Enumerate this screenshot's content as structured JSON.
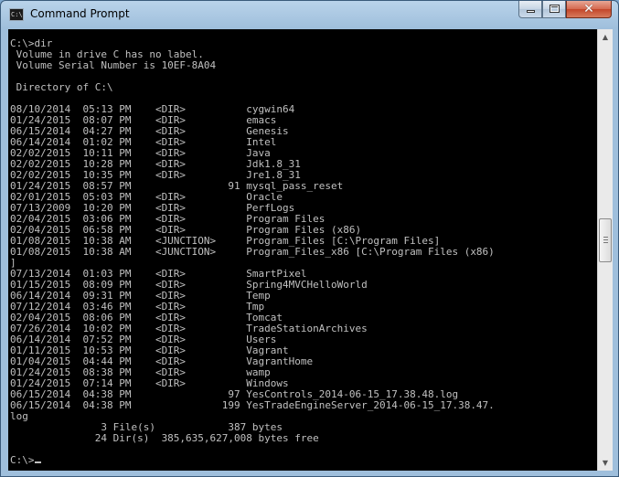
{
  "window": {
    "title": "Command Prompt",
    "icon_label": "C:\\",
    "icon": "console-icon",
    "controls": [
      "minimize-icon",
      "maximize-icon",
      "close-icon"
    ]
  },
  "console": {
    "foreground": "#c0c0c0",
    "background": "#000000",
    "lines": [
      "C:\\>dir",
      " Volume in drive C has no label.",
      " Volume Serial Number is 10EF-8A04",
      "",
      " Directory of C:\\",
      "",
      "08/10/2014  05:13 PM    <DIR>          cygwin64",
      "01/24/2015  08:07 PM    <DIR>          emacs",
      "06/15/2014  04:27 PM    <DIR>          Genesis",
      "06/14/2014  01:02 PM    <DIR>          Intel",
      "02/02/2015  10:11 PM    <DIR>          Java",
      "02/02/2015  10:28 PM    <DIR>          Jdk1.8_31",
      "02/02/2015  10:35 PM    <DIR>          Jre1.8_31",
      "01/24/2015  08:57 PM                91 mysql_pass_reset",
      "02/01/2015  05:03 PM    <DIR>          Oracle",
      "07/13/2009  10:20 PM    <DIR>          PerfLogs",
      "02/04/2015  03:06 PM    <DIR>          Program Files",
      "02/04/2015  06:58 PM    <DIR>          Program Files (x86)",
      "01/08/2015  10:38 AM    <JUNCTION>     Program_Files [C:\\Program Files]",
      "01/08/2015  10:38 AM    <JUNCTION>     Program_Files_x86 [C:\\Program Files (x86)",
      "]",
      "07/13/2014  01:03 PM    <DIR>          SmartPixel",
      "01/15/2015  08:09 PM    <DIR>          Spring4MVCHelloWorld",
      "06/14/2014  09:31 PM    <DIR>          Temp",
      "07/12/2014  03:46 PM    <DIR>          Tmp",
      "02/04/2015  08:06 PM    <DIR>          Tomcat",
      "07/26/2014  10:02 PM    <DIR>          TradeStationArchives",
      "06/14/2014  07:52 PM    <DIR>          Users",
      "01/11/2015  10:53 PM    <DIR>          Vagrant",
      "01/04/2015  04:44 PM    <DIR>          VagrantHome",
      "01/24/2015  08:38 PM    <DIR>          wamp",
      "01/24/2015  07:14 PM    <DIR>          Windows",
      "06/15/2014  04:38 PM                97 YesControls_2014-06-15_17.38.48.log",
      "06/15/2014  04:38 PM               199 YesTradeEngineServer_2014-06-15_17.38.47.",
      "log",
      "               3 File(s)            387 bytes",
      "              24 Dir(s)  385,635,627,008 bytes free",
      ""
    ],
    "prompt": "C:\\>"
  },
  "scrollbar": {
    "up_arrow": "scroll-up-arrow-icon",
    "down_arrow": "scroll-down-arrow-icon",
    "thumb_position_fraction": 0.42
  }
}
